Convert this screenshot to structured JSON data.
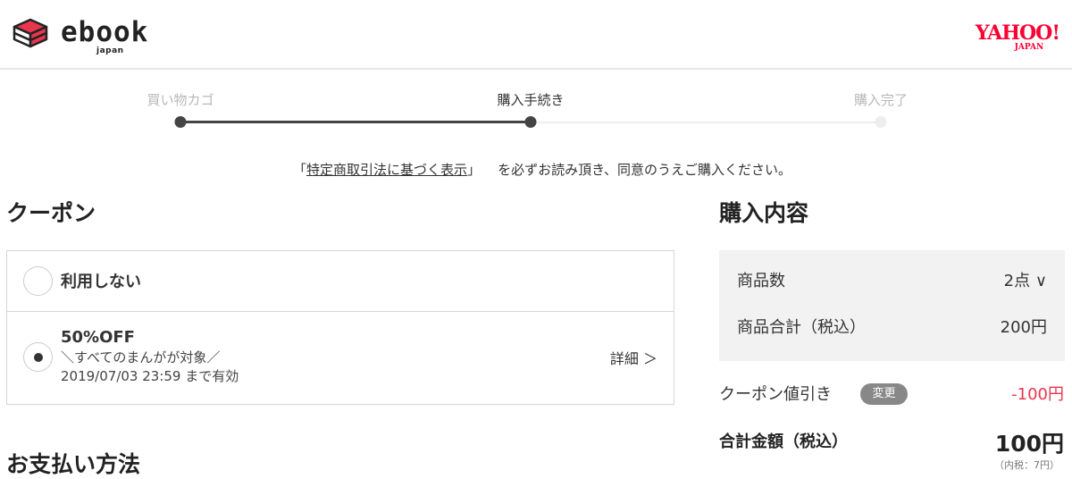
{
  "header": {
    "logo_text": "ebook",
    "logo_sub": "japan",
    "partner_main": "YAHOO!",
    "partner_sub": "JAPAN"
  },
  "steps": [
    {
      "label": "買い物カゴ",
      "state": "done"
    },
    {
      "label": "購入手続き",
      "state": "current"
    },
    {
      "label": "購入完了",
      "state": "todo"
    }
  ],
  "notice": {
    "open": "「",
    "link": "特定商取引法に基づく表示",
    "close": "」",
    "text": "を必ずお読み頂き、同意のうえご購入ください。"
  },
  "coupon": {
    "title": "クーポン",
    "options": [
      {
        "label": "利用しない",
        "selected": false
      },
      {
        "label": "50%OFF",
        "line1": "＼すべてのまんがが対象／",
        "line2": "2019/07/03 23:59 まで有効",
        "selected": true,
        "detail": "詳細 ＞"
      }
    ]
  },
  "payment": {
    "title": "お支払い方法"
  },
  "summary": {
    "title": "購入内容",
    "count_label": "商品数",
    "count_value": "2点 ∨",
    "subtotal_label": "商品合計（税込）",
    "subtotal_value": "200円",
    "discount_label": "クーポン値引き",
    "change_button": "変更",
    "discount_value": "-100円",
    "total_label": "合計金額（税込）",
    "total_value": "100円",
    "tax_note": "（内税：7円）"
  },
  "colors": {
    "accent_red": "#e8364d",
    "yahoo_red": "#ff0033",
    "step_active": "#444444"
  }
}
